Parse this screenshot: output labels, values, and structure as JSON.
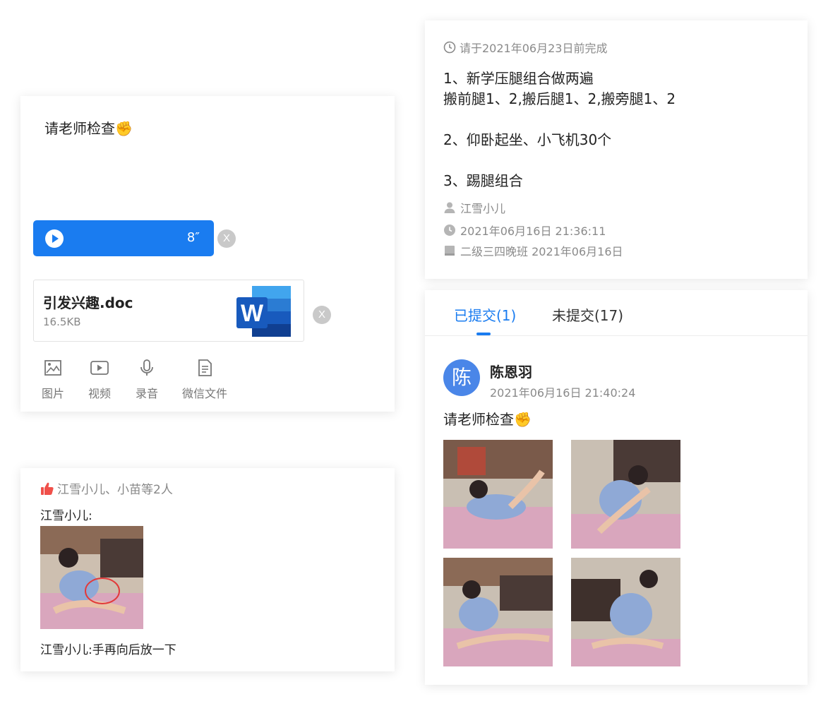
{
  "compose": {
    "text": "请老师检查✊",
    "audio_duration": "8″",
    "remove_label": "X",
    "file": {
      "name": "引发兴趣.doc",
      "size": "16.5KB",
      "icon": "word-doc-icon"
    },
    "toolbar": [
      {
        "label": "图片",
        "icon": "image-icon"
      },
      {
        "label": "视频",
        "icon": "video-icon"
      },
      {
        "label": "录音",
        "icon": "microphone-icon"
      },
      {
        "label": "微信文件",
        "icon": "document-icon"
      }
    ]
  },
  "comment": {
    "likes": "江雪小儿、小苗等2人",
    "author": "江雪小儿:",
    "text": "江雪小儿:手再向后放一下"
  },
  "task": {
    "due": "请于2021年06月23日前完成",
    "lines": [
      "1、新学压腿组合做两遍",
      "搬前腿1、2,搬后腿1、2,搬旁腿1、2",
      "2、仰卧起坐、小飞机30个",
      "3、踢腿组合"
    ],
    "teacher": "江雪小儿",
    "created": "2021年06月16日 21:36:11",
    "class": "二级三四晚班 2021年06月16日"
  },
  "submissions": {
    "tabs": [
      {
        "label": "已提交(1)",
        "active": true
      },
      {
        "label": "未提交(17)",
        "active": false
      }
    ],
    "entry": {
      "avatar_char": "陈",
      "name": "陈恩羽",
      "time": "2021年06月16日 21:40:24",
      "text": "请老师检查✊"
    }
  },
  "colors": {
    "accent": "#1a7cf0",
    "like": "#f0504a",
    "avatar": "#4a86e8",
    "mat": "#d9a6bd"
  }
}
